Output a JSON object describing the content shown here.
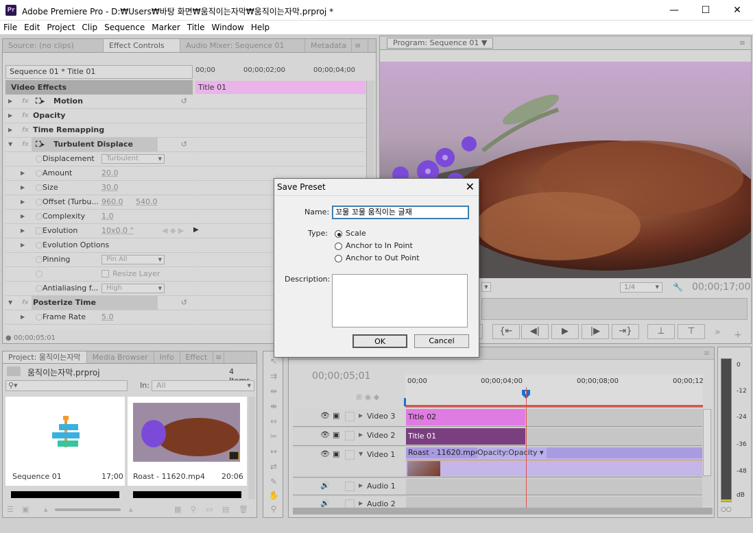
{
  "app": {
    "title": "Adobe Premiere Pro - D:₩Users₩바탕 화면₩움직이는자막₩움직이는자막.prproj *",
    "logo": "Pr",
    "minimize": "—",
    "maximize": "☐",
    "close": "✕"
  },
  "menu": [
    "File",
    "Edit",
    "Project",
    "Clip",
    "Sequence",
    "Marker",
    "Title",
    "Window",
    "Help"
  ],
  "top_left_tabs": [
    "Source: (no clips)",
    "Effect Controls",
    "Audio Mixer: Sequence 01",
    "Metadata"
  ],
  "effect_controls": {
    "sequence_label": "Sequence 01 * Title 01",
    "timecodes": [
      "00;00",
      "00;00;02;00",
      "00;00;04;00"
    ],
    "video_effects": "Video Effects",
    "clip_label": "Title 01",
    "rows": [
      {
        "name": "Motion",
        "value": "",
        "indent": 0,
        "bold": true
      },
      {
        "name": "Opacity",
        "value": "",
        "indent": 0,
        "bold": true
      },
      {
        "name": "Time Remapping",
        "value": "",
        "indent": 0,
        "bold": true
      },
      {
        "name": "Turbulent Displace",
        "value": "",
        "indent": 0,
        "bold": true
      },
      {
        "name": "Displacement",
        "value": "Turbulent",
        "indent": 1
      },
      {
        "name": "Amount",
        "value": "20.0",
        "indent": 1
      },
      {
        "name": "Size",
        "value": "30.0",
        "indent": 1
      },
      {
        "name": "Offset (Turbu...",
        "value": "960.0",
        "value2": "540.0",
        "indent": 1
      },
      {
        "name": "Complexity",
        "value": "1.0",
        "indent": 1
      },
      {
        "name": "Evolution",
        "value": "10x0.0 °",
        "indent": 1
      },
      {
        "name": "Evolution Options",
        "value": "",
        "indent": 1
      },
      {
        "name": "Pinning",
        "value": "Pin All",
        "indent": 1
      },
      {
        "name": "",
        "value": "Resize Layer",
        "indent": 1
      },
      {
        "name": "Antialiasing f...",
        "value": "High",
        "indent": 1
      },
      {
        "name": "Posterize Time",
        "value": "",
        "indent": 0,
        "bold": true
      },
      {
        "name": "Frame Rate",
        "value": "5.0",
        "indent": 1
      }
    ],
    "footer_time": "00;00;05;01"
  },
  "program": {
    "tab": "Program: Sequence 01",
    "fit": "1/4",
    "timecode": "00;00;17;00"
  },
  "dialog": {
    "title": "Save Preset",
    "close": "✕",
    "name_label": "Name:",
    "name_value": "꼬물 꼬물 움직이는 글재",
    "type_label": "Type:",
    "types": [
      "Scale",
      "Anchor to In Point",
      "Anchor to Out Point"
    ],
    "selected_type": "Scale",
    "description_label": "Description:",
    "description_value": "",
    "ok": "OK",
    "cancel": "Cancel"
  },
  "project": {
    "tabs": [
      "Project: 움직이는자막",
      "Media Browser",
      "Info",
      "Effect"
    ],
    "file": "움직이는자막.prproj",
    "count": "4 Items",
    "search_placeholder": "",
    "in_label": "In:",
    "in_value": "All",
    "items": [
      {
        "name": "Sequence 01",
        "duration": "17;00"
      },
      {
        "name": "Roast - 11620.mp4",
        "duration": "20:06"
      }
    ]
  },
  "timeline": {
    "timecode": "00;00;05;01",
    "ruler": [
      "00;00",
      "00;00;04;00",
      "00;00;08;00",
      "00;00;12"
    ],
    "tracks": [
      {
        "name": "Video 3",
        "clip": "Title 02",
        "color": "#e07be3"
      },
      {
        "name": "Video 2",
        "clip": "Title 01",
        "color": "#7a3f7f"
      },
      {
        "name": "Video 1",
        "clip": "Roast - 11620.mp4",
        "opacity": "Opacity:Opacity",
        "color": "#a89be0"
      },
      {
        "name": "Audio 1",
        "clip": "",
        "color": "#ccc"
      },
      {
        "name": "Audio 2",
        "clip": "",
        "color": "#ccc"
      }
    ]
  },
  "meter": {
    "labels": [
      "0",
      "-12",
      "-24",
      "-36",
      "-48",
      "dB"
    ]
  }
}
